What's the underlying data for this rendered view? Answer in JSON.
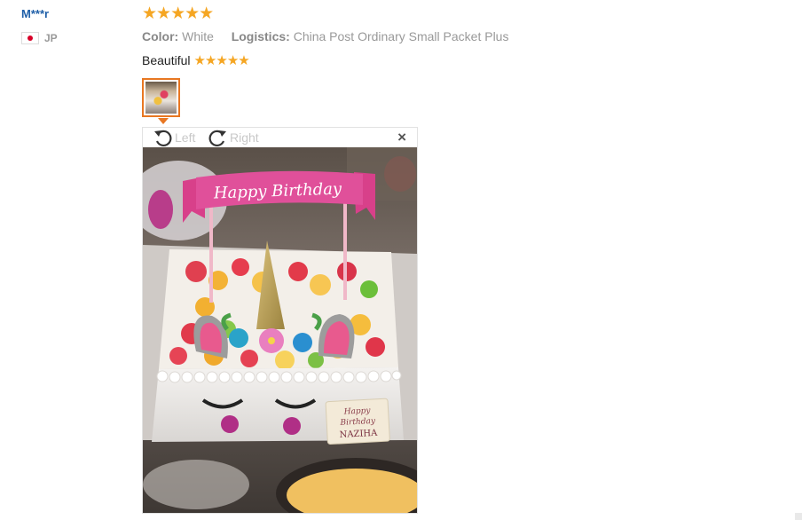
{
  "reviewer": {
    "name": "M***r",
    "country_code": "JP",
    "flag_icon": "japan-flag-icon"
  },
  "review": {
    "rating": 5,
    "stars": "★★★★★",
    "color_label": "Color:",
    "color_value": "White",
    "logistics_label": "Logistics:",
    "logistics_value": "China Post Ordinary Small Packet Plus",
    "text": "Beautiful",
    "text_stars": "★★★★★"
  },
  "viewer": {
    "rotate_left_label": "Left",
    "rotate_right_label": "Right",
    "close_symbol": "×"
  },
  "photo": {
    "banner_text": "Happy Birthday",
    "plaque_lines": [
      "Happy",
      "Birthday",
      "NAZIHA"
    ]
  },
  "colors": {
    "accent": "#e87722",
    "star": "#f5a623",
    "link": "#1f5fa8",
    "muted": "#999999"
  }
}
